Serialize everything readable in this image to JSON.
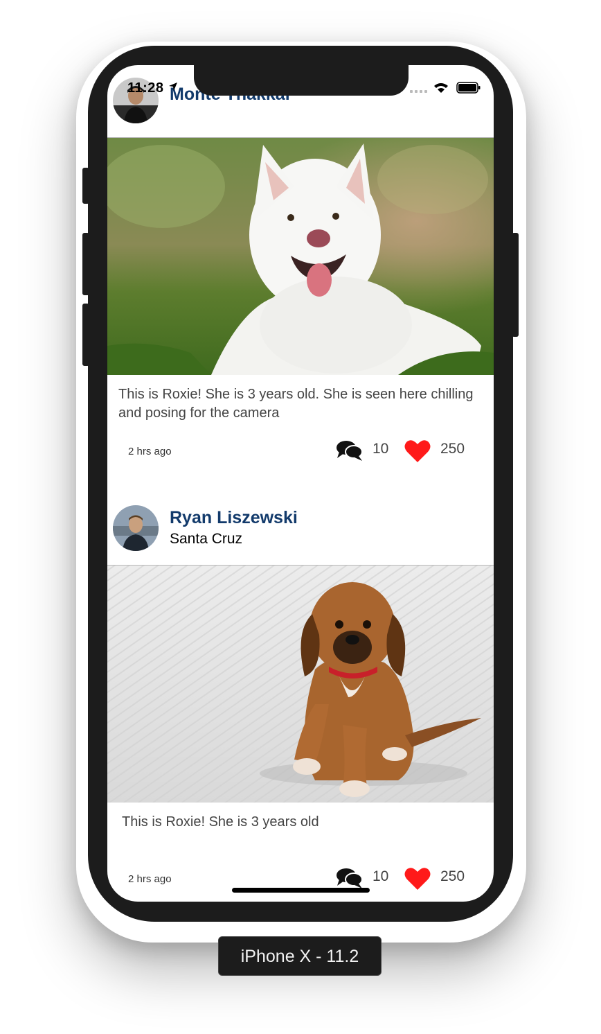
{
  "status_bar": {
    "time": "11:28"
  },
  "device_label": "iPhone X - 11.2",
  "posts": [
    {
      "author": "Monte Thakkar",
      "location": "",
      "caption": "This is Roxie! She is 3 years old. She is seen here chilling and posing for the camera",
      "time_ago": "2 hrs ago",
      "comments": "10",
      "likes": "250"
    },
    {
      "author": "Ryan Liszewski",
      "location": "Santa Cruz",
      "caption": "This is Roxie! She is 3 years old",
      "time_ago": "2 hrs ago",
      "comments": "10",
      "likes": "250"
    }
  ],
  "colors": {
    "author_name": "#123a6b",
    "like_heart": "#ff1a1a",
    "device_frame": "#1c1c1c"
  },
  "icons": [
    "comments-icon",
    "heart-icon",
    "location-arrow-icon",
    "wifi-icon",
    "battery-icon",
    "signal-icon"
  ]
}
